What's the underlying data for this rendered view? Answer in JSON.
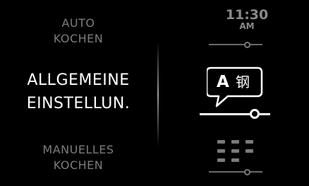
{
  "menu": {
    "auto_cooking": {
      "line1": "AUTO",
      "line2": "KOCHEN"
    },
    "general_settings": {
      "line1": "ALLGEMEINE",
      "line2": "EINSTELLUN."
    },
    "manual_cooking": {
      "line1": "MANUELLES",
      "line2": "KOCHEN"
    }
  },
  "clock": {
    "time": "11:30",
    "ampm": "AM"
  },
  "language_icon": {
    "letter": "A",
    "glyph": "钢"
  },
  "sliders": {
    "time": {
      "level": 0.72
    },
    "language": {
      "level": 0.78
    },
    "manual": {
      "level": 0.72
    }
  },
  "colors": {
    "background": "#000000",
    "active_text": "#ffffff",
    "inactive_text": "#7c7c7c",
    "inactive_icon": "#7a7a7a"
  },
  "icons": {
    "language": "language-speech-bubble-icon",
    "grid": "grid-dots-icon"
  }
}
